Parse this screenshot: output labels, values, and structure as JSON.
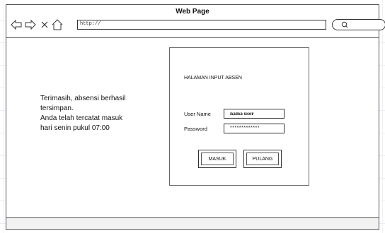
{
  "window": {
    "title": "Web Page",
    "address": "http://"
  },
  "icons": {
    "back": "arrow-left-icon",
    "forward": "arrow-right-icon",
    "close": "close-icon",
    "home": "home-icon",
    "search": "search-icon"
  },
  "message": {
    "line1": "Terimasih, absensi berhasil",
    "line2": "tersimpan.",
    "line3": "Anda telah tercatat masuk",
    "line4": "hari senin pukul 07:00"
  },
  "form": {
    "title": "HALAMAN INPUT  ABSEN",
    "username_label": "User Name",
    "username_value": "nama user",
    "password_label": "Password",
    "password_value": "*************",
    "masuk_label": "MASUK",
    "pulang_label": "PULANG"
  }
}
